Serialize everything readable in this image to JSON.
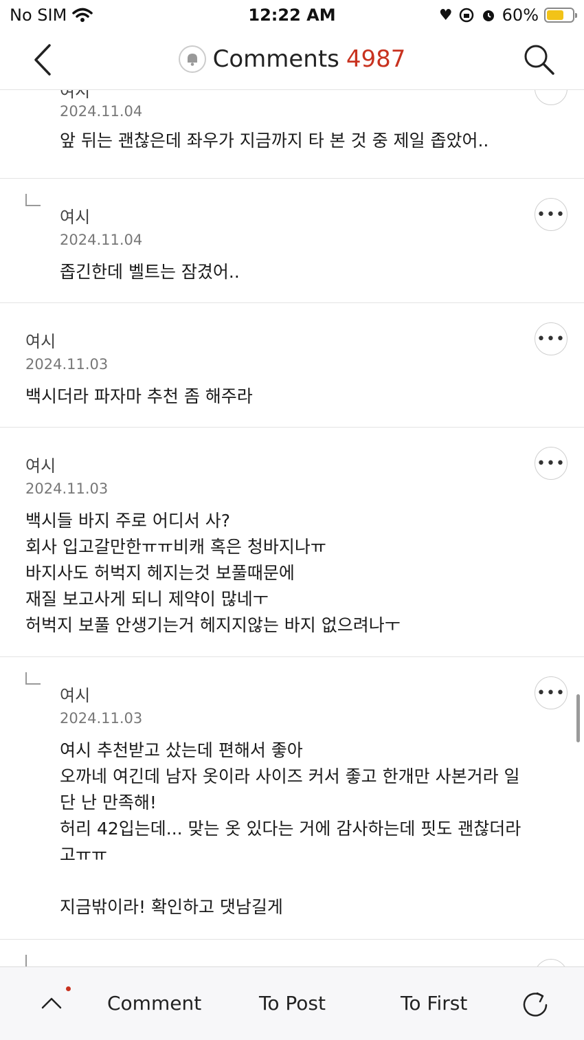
{
  "status": {
    "carrier": "No SIM",
    "time": "12:22 AM",
    "battery": "60%"
  },
  "nav": {
    "title": "Comments",
    "count": "4987"
  },
  "comments": [
    {
      "author": "여시",
      "date": "2024.11.04",
      "body": "앞 뒤는 괜찮은데 좌우가 지금까지 타 본 것 중 제일 좁았어.."
    },
    {
      "author": "여시",
      "date": "2024.11.04",
      "body": "좁긴한데 벨트는 잠겼어.."
    },
    {
      "author": "여시",
      "date": "2024.11.03",
      "body": "백시더라 파자마 추천 좀 해주라"
    },
    {
      "author": "여시",
      "date": "2024.11.03",
      "body": "백시들 바지 주로 어디서 사?\n회사 입고갈만한ㅠㅠ비캐 혹은 청바지나ㅠ\n바지사도 허벅지 헤지는것 보풀때문에\n재질 보고사게 되니 제약이 많네ㅜ\n허벅지 보풀 안생기는거 헤지지않는 바지 없으려나ㅜ"
    },
    {
      "author": "여시",
      "date": "2024.11.03",
      "body": "여시 추천받고 샀는데 편해서 좋아\n오까네 여긴데 남자 옷이라 사이즈 커서 좋고 한개만 사본거라 일\n단 난 만족해!\n허리 42입는데... 맞는 옷 있다는 거에 감사하는데 핏도 괜찮더라\n고ㅠㅠ\n\n지금밖이라! 확인하고 댓남길게"
    }
  ],
  "more_label": "•••",
  "toolbar": {
    "comment": "Comment",
    "to_post": "To Post",
    "to_first": "To First"
  }
}
